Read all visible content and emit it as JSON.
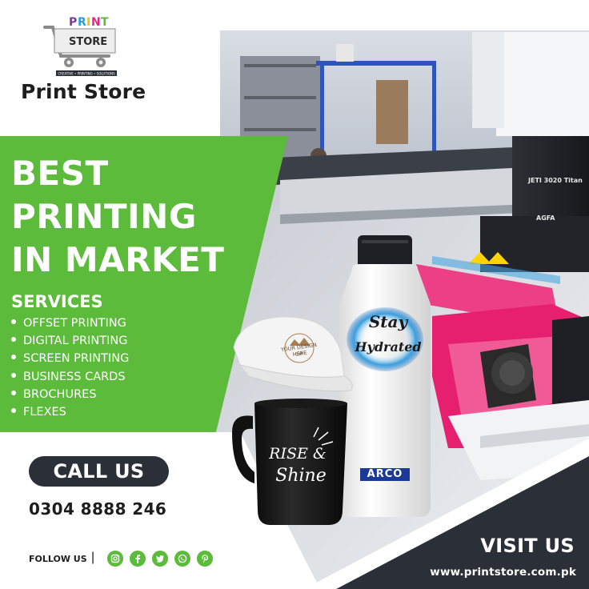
{
  "brand": {
    "logo_word_1": "PRINT",
    "logo_word_2": "STORE",
    "logo_tagline": "CREATIVE • PRINTING • SOLUTIONS",
    "name": "Print Store"
  },
  "headline": {
    "line_1": "BEST",
    "line_2": "PRINTING",
    "line_3": "IN MARKET"
  },
  "services": {
    "title": "SERVICES",
    "items": [
      "OFFSET PRINTING",
      "DIGITAL PRINTING",
      "SCREEN PRINTING",
      "BUSINESS CARDS",
      "BROCHURES",
      "FLEXES"
    ]
  },
  "contact": {
    "call_label": "CALL US",
    "phone": "0304 8888 246",
    "follow_label": "FOLLOW US",
    "separator": "|",
    "social_icons": [
      "instagram-icon",
      "facebook-icon",
      "twitter-icon",
      "whatsapp-icon",
      "pinterest-icon"
    ],
    "visit_label": "VISIT US",
    "website": "www.printstore.com.pk"
  },
  "products": {
    "bottle_line_1": "Stay",
    "bottle_line_2": "Hydrated",
    "bottle_brand": "ARCO",
    "mug_line_1": "RISE &",
    "mug_line_2": "Shine",
    "cap_line_1": "YOUR DESIGN HERE",
    "cap_line_2": "CAP"
  },
  "photo": {
    "machine_label": "JETI 3020 Titan",
    "machine_brand": "AGFA"
  },
  "colors": {
    "green": "#5dbb3c",
    "dark": "#2b2f38",
    "white": "#ffffff"
  }
}
